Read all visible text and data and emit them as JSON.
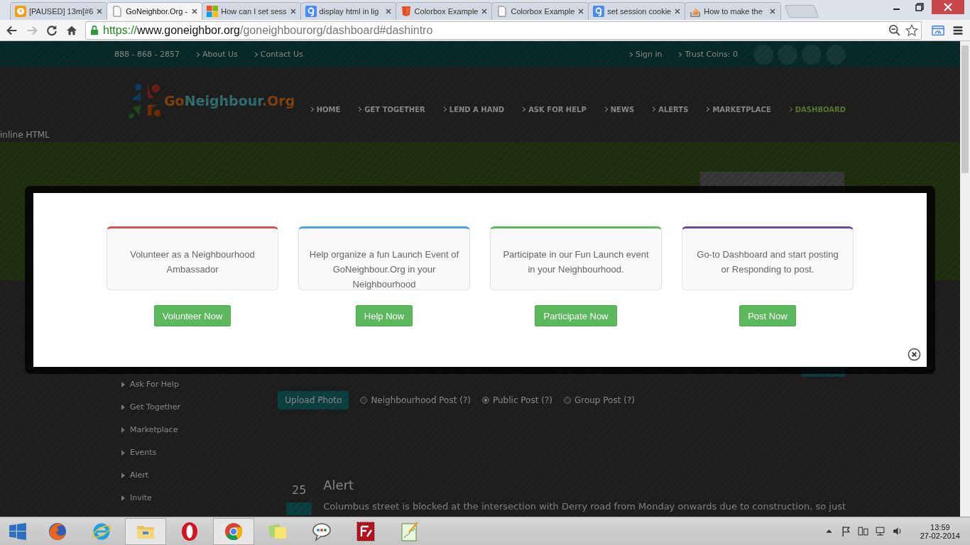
{
  "browser": {
    "tabs": [
      {
        "title": "[PAUSED] 13m[#6",
        "kind": "timer",
        "selected": false
      },
      {
        "title": "GoNeighbor.Org -",
        "kind": "page",
        "selected": true
      },
      {
        "title": "How can I set sess",
        "kind": "windows",
        "selected": false
      },
      {
        "title": "display html in lig",
        "kind": "google",
        "selected": false
      },
      {
        "title": "Colorbox Example",
        "kind": "html5",
        "selected": false
      },
      {
        "title": "Colorbox Example",
        "kind": "page",
        "selected": false
      },
      {
        "title": "set session cookie",
        "kind": "google",
        "selected": false
      },
      {
        "title": "How to make the",
        "kind": "stack",
        "selected": false
      }
    ],
    "address": {
      "scheme": "https://",
      "host": "www.goneighbor.org",
      "path": "/goneighbourorg/dashboard#dashintro"
    }
  },
  "page": {
    "top_bar": {
      "phone": "888 - 868 - 2857",
      "links": [
        "About Us",
        "Contact Us"
      ],
      "account_links": [
        "Sign in",
        "Trust Coins: 0"
      ]
    },
    "logo": {
      "first": "Go",
      "middle": "Neighbour",
      "last": ".Org"
    },
    "nav": [
      {
        "label": "HOME",
        "selected": false
      },
      {
        "label": "GET TOGETHER",
        "selected": false
      },
      {
        "label": "LEND A HAND",
        "selected": false
      },
      {
        "label": "ASK FOR HELP",
        "selected": false
      },
      {
        "label": "NEWS",
        "selected": false
      },
      {
        "label": "ALERTS",
        "selected": false
      },
      {
        "label": "MARKETPLACE",
        "selected": false
      },
      {
        "label": "DASHBOARD",
        "selected": true
      }
    ],
    "inline_label": "inline HTML",
    "sidebar": [
      "Ask For Help",
      "Get Together",
      "Marketplace",
      "Events",
      "Alert",
      "Invite"
    ],
    "upload_button": "Upload Photo",
    "post_types": [
      {
        "label": "Neighbourhood Post (?)",
        "selected": false
      },
      {
        "label": "Public Post (?)",
        "selected": true
      },
      {
        "label": "Group Post (?)",
        "selected": false
      }
    ],
    "post": {
      "day": "25",
      "title": "Alert",
      "text": "Columbus street is blocked at the intersection with Derry road from Monday onwards due to construction, so just"
    }
  },
  "modal": {
    "cards": [
      {
        "text": "Volunteer as a Neighbourhood Ambassador",
        "button": "Volunteer Now",
        "color": "#d9534f"
      },
      {
        "text": "Help organize a fun Launch Event of GoNeighbour.Org in your Neighbourhood",
        "button": "Help Now",
        "color": "#4aa3df"
      },
      {
        "text": "Participate in our Fun Launch event in your Neighbourhood.",
        "button": "Participate Now",
        "color": "#5cb85c"
      },
      {
        "text": "Go-to Dashboard and start posting or Responding to post.",
        "button": "Post Now",
        "color": "#6a4c9c"
      }
    ]
  },
  "taskbar": {
    "apps": [
      {
        "kind": "firefox",
        "active": false
      },
      {
        "kind": "ie",
        "active": false
      },
      {
        "kind": "explorer",
        "active": true
      },
      {
        "kind": "opera",
        "active": false
      },
      {
        "kind": "chrome",
        "active": true
      },
      {
        "kind": "notes",
        "active": false
      },
      {
        "kind": "chat",
        "active": false
      },
      {
        "kind": "ftp",
        "active": false
      },
      {
        "kind": "editor",
        "active": false
      }
    ],
    "time": "13:59",
    "date": "27-02-2014"
  }
}
